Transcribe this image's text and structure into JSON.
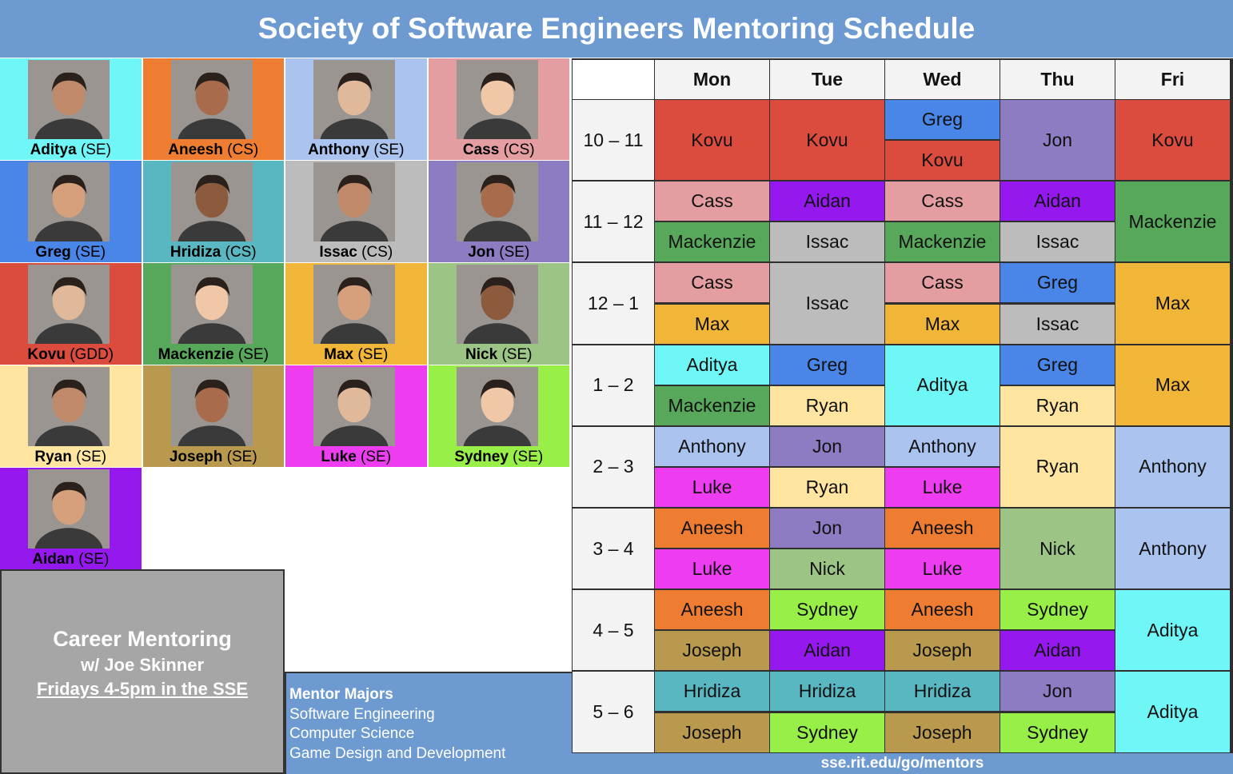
{
  "title": "Society of Software Engineers Mentoring Schedule",
  "colors": {
    "header_blue": "#6d9bd1",
    "Aditya": "#6ff7f7",
    "Aneesh": "#ef7d31",
    "Anthony": "#aac4ef",
    "Cass": "#e49da0",
    "Greg": "#4a86e8",
    "Hridiza": "#59b7c2",
    "Issac": "#bcbcbc",
    "Jon": "#8e7cc3",
    "Kovu": "#dc4c3e",
    "Mackenzie": "#57a85b",
    "Max": "#f1b537",
    "Nick": "#9cc485",
    "Ryan": "#ffe5a0",
    "Joseph": "#b9994e",
    "Luke": "#ee3cf0",
    "Sydney": "#98ef47",
    "Aidan": "#9518ef"
  },
  "mentors": [
    {
      "name": "Aditya",
      "major": "(SE)",
      "color": "#6ff7f7"
    },
    {
      "name": "Aneesh",
      "major": "(CS)",
      "color": "#ef7d31"
    },
    {
      "name": "Anthony",
      "major": "(SE)",
      "color": "#aac4ef"
    },
    {
      "name": "Cass",
      "major": "(CS)",
      "color": "#e49da0"
    },
    {
      "name": "Greg",
      "major": "(SE)",
      "color": "#4a86e8"
    },
    {
      "name": "Hridiza",
      "major": "(CS)",
      "color": "#59b7c2"
    },
    {
      "name": "Issac",
      "major": "(CS)",
      "color": "#bcbcbc"
    },
    {
      "name": "Jon",
      "major": "(SE)",
      "color": "#8e7cc3"
    },
    {
      "name": "Kovu",
      "major": "(GDD)",
      "color": "#dc4c3e"
    },
    {
      "name": "Mackenzie",
      "major": "(SE)",
      "color": "#57a85b"
    },
    {
      "name": "Max",
      "major": "(SE)",
      "color": "#f1b537"
    },
    {
      "name": "Nick",
      "major": "(SE)",
      "color": "#9cc485"
    },
    {
      "name": "Ryan",
      "major": "(SE)",
      "color": "#ffe5a0"
    },
    {
      "name": "Joseph",
      "major": "(SE)",
      "color": "#b9994e"
    },
    {
      "name": "Luke",
      "major": "(SE)",
      "color": "#ee3cf0"
    },
    {
      "name": "Sydney",
      "major": "(SE)",
      "color": "#98ef47"
    },
    {
      "name": "Aidan",
      "major": "(SE)",
      "color": "#9518ef"
    }
  ],
  "career": {
    "line1": "Career Mentoring",
    "line2": "w/ Joe Skinner",
    "line3": "Fridays 4-5pm in the SSE"
  },
  "majors": {
    "heading": "Mentor Majors",
    "items": [
      "Software Engineering",
      "Computer Science",
      "Game Design and Development"
    ]
  },
  "schedule": {
    "days": [
      "Mon",
      "Tue",
      "Wed",
      "Thu",
      "Fri"
    ],
    "times": [
      "10 – 11",
      "11 – 12",
      "12 – 1",
      "1 – 2",
      "2 – 3",
      "3 – 4",
      "4 – 5",
      "5 – 6"
    ],
    "slots": [
      [
        [
          "Kovu"
        ],
        [
          "Kovu"
        ],
        [
          "Greg",
          "Kovu"
        ],
        [
          "Jon"
        ],
        [
          "Kovu"
        ]
      ],
      [
        [
          "Cass",
          "Mackenzie"
        ],
        [
          "Aidan",
          "Issac"
        ],
        [
          "Cass",
          "Mackenzie"
        ],
        [
          "Aidan",
          "Issac"
        ],
        [
          "Mackenzie"
        ]
      ],
      [
        [
          "Cass",
          "Max"
        ],
        [
          "Issac"
        ],
        [
          "Cass",
          "Max"
        ],
        [
          "Greg",
          "Issac"
        ],
        [
          "Max"
        ]
      ],
      [
        [
          "Aditya",
          "Mackenzie"
        ],
        [
          "Greg",
          "Ryan"
        ],
        [
          "Aditya"
        ],
        [
          "Greg",
          "Ryan"
        ],
        [
          "Max"
        ]
      ],
      [
        [
          "Anthony",
          "Luke"
        ],
        [
          "Jon",
          "Ryan"
        ],
        [
          "Anthony",
          "Luke"
        ],
        [
          "Ryan"
        ],
        [
          "Anthony"
        ]
      ],
      [
        [
          "Aneesh",
          "Luke"
        ],
        [
          "Jon",
          "Nick"
        ],
        [
          "Aneesh",
          "Luke"
        ],
        [
          "Nick"
        ],
        [
          "Anthony"
        ]
      ],
      [
        [
          "Aneesh",
          "Joseph"
        ],
        [
          "Sydney",
          "Aidan"
        ],
        [
          "Aneesh",
          "Joseph"
        ],
        [
          "Sydney",
          "Aidan"
        ],
        [
          "Aditya"
        ]
      ],
      [
        [
          "Hridiza",
          "Joseph"
        ],
        [
          "Hridiza",
          "Sydney"
        ],
        [
          "Hridiza",
          "Joseph"
        ],
        [
          "Jon",
          "Sydney"
        ],
        [
          "Aditya"
        ]
      ]
    ]
  },
  "footer": "sse.rit.edu/go/mentors"
}
